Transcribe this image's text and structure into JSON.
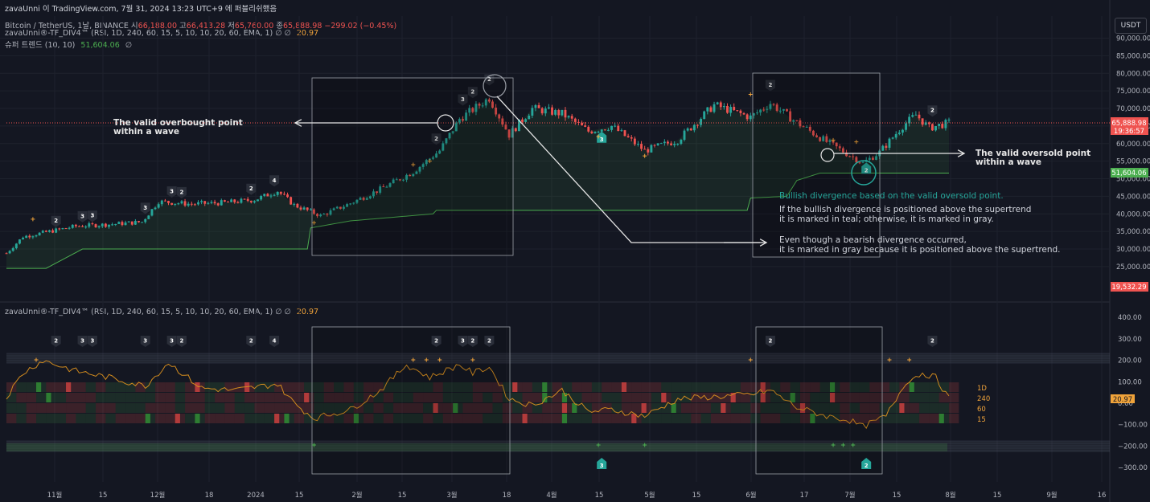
{
  "header": {
    "top_line": "zavaUnni 이 TradingView.com, 7월 31, 2024 13:23 UTC+9 에 퍼블리쉬했음",
    "symbol": "Bitcoin / TetherUS, 1날, BINANCE",
    "ohlc": [
      {
        "label": "시",
        "value": "66,188.00"
      },
      {
        "label": "고",
        "value": "66,413.28"
      },
      {
        "label": "저",
        "value": "65,760.00"
      },
      {
        "label": "종",
        "value": "65,888.98"
      }
    ],
    "change": "−299.02 (−0.45%)",
    "indicator1": "zavaUnni®-TF_DIV4™ (RSI, 1D, 240, 60, 15, 5, 10, 10, 20, 60, EMA, 1)  ∅  ∅",
    "indicator1_value": "20.97",
    "indicator2": "슈퍼 트렌드 (10, 10)",
    "indicator2_value": "51,604.06",
    "indicator2_suffix": "∅",
    "oscillator": "zavaUnni®-TF_DIV4™ (RSI, 1D, 240, 60, 15, 5, 10, 10, 20, 60, EMA, 1)  ∅  ∅",
    "oscillator_value": "20.97"
  },
  "currency_button": "USDT",
  "colors": {
    "background": "#141722",
    "up": "#26a69a",
    "down": "#ef5350",
    "supertrend": "#4caf50",
    "rsi": "#d08a1e",
    "teal": "#26a69a",
    "annotation": "#e6e6e6",
    "plus": "#f0a33a",
    "grid": "#1e222d"
  },
  "annotations": {
    "overbought": [
      "The valid overbought point",
      "within a wave"
    ],
    "oversold": [
      "The valid oversold point",
      "within a wave"
    ],
    "bullish_title": "Bullish divergence based on the valid oversold point.",
    "bullish_body": [
      "If the bullish divergence is positioned above the supertrend",
      "it is marked in teal; otherwise, it is marked in gray."
    ],
    "bearish": [
      "Even though a bearish divergence occurred,",
      "it is marked in gray because it is positioned above the supertrend."
    ]
  },
  "price_badges": {
    "current": "65,888.98",
    "countdown": "19:36:57",
    "supertrend": "51,604.06",
    "low": "19,532.29",
    "oscillator": "20.97"
  },
  "chart_data": [
    {
      "type": "candlestick",
      "title": "Bitcoin / TetherUS, 1날, BINANCE",
      "ylim": [
        20000,
        92000
      ],
      "y_ticks": [
        "90,000.00",
        "85,000.00",
        "80,000.00",
        "75,000.00",
        "70,000.00",
        "65,000.00",
        "60,000.00",
        "55,000.00",
        "50,000.00",
        "45,000.00",
        "40,000.00",
        "35,000.00",
        "30,000.00",
        "25,000.00"
      ],
      "x_ticks": [
        "11월",
        "15",
        "12월",
        "18",
        "2024",
        "15",
        "2월",
        "15",
        "3월",
        "18",
        "4월",
        "15",
        "5월",
        "15",
        "6월",
        "17",
        "7월",
        "15",
        "8월",
        "15",
        "9월",
        "16"
      ],
      "close_path": [
        [
          "2023-10-20",
          28800
        ],
        [
          "2023-10-25",
          33500
        ],
        [
          "2023-11-01",
          34800
        ],
        [
          "2023-11-10",
          36500
        ],
        [
          "2023-11-20",
          37000
        ],
        [
          "2023-11-30",
          37700
        ],
        [
          "2023-12-05",
          43500
        ],
        [
          "2023-12-15",
          42800
        ],
        [
          "2023-12-25",
          43200
        ],
        [
          "2024-01-03",
          44000
        ],
        [
          "2024-01-10",
          46500
        ],
        [
          "2024-01-15",
          42500
        ],
        [
          "2024-01-23",
          39500
        ],
        [
          "2024-02-01",
          43000
        ],
        [
          "2024-02-10",
          47000
        ],
        [
          "2024-02-20",
          52000
        ],
        [
          "2024-02-28",
          58000
        ],
        [
          "2024-03-05",
          67000
        ],
        [
          "2024-03-14",
          73000
        ],
        [
          "2024-03-20",
          62500
        ],
        [
          "2024-03-27",
          70000
        ],
        [
          "2024-04-05",
          68500
        ],
        [
          "2024-04-13",
          63500
        ],
        [
          "2024-04-20",
          65000
        ],
        [
          "2024-04-30",
          58000
        ],
        [
          "2024-05-10",
          61000
        ],
        [
          "2024-05-21",
          71000
        ],
        [
          "2024-06-01",
          67500
        ],
        [
          "2024-06-07",
          71500
        ],
        [
          "2024-06-15",
          66000
        ],
        [
          "2024-06-24",
          60500
        ],
        [
          "2024-07-05",
          54500
        ],
        [
          "2024-07-10",
          57500
        ],
        [
          "2024-07-17",
          65000
        ],
        [
          "2024-07-21",
          68200
        ],
        [
          "2024-07-25",
          64500
        ],
        [
          "2024-07-31",
          65888.98
        ]
      ],
      "supertrend": [
        [
          "2023-10-20",
          24500
        ],
        [
          "2023-11-01",
          24500
        ],
        [
          "2023-11-12",
          30000
        ],
        [
          "2024-01-19",
          30000
        ],
        [
          "2024-01-20",
          36000
        ],
        [
          "2024-02-01",
          38000
        ],
        [
          "2024-02-26",
          40000
        ],
        [
          "2024-02-27",
          41000
        ],
        [
          "2024-05-31",
          41000
        ],
        [
          "2024-06-01",
          44500
        ],
        [
          "2024-06-12",
          45000
        ],
        [
          "2024-06-15",
          49500
        ],
        [
          "2024-06-22",
          51604.06
        ],
        [
          "2024-07-31",
          51604.06
        ]
      ],
      "divergence_labels": [
        {
          "date": "2023-11-04",
          "text": "2"
        },
        {
          "date": "2023-11-12",
          "text": "3"
        },
        {
          "date": "2023-11-15",
          "text": "3"
        },
        {
          "date": "2023-12-01",
          "text": "3"
        },
        {
          "date": "2023-12-09",
          "text": "3"
        },
        {
          "date": "2023-12-12",
          "text": "2"
        },
        {
          "date": "2024-01-02",
          "text": "2"
        },
        {
          "date": "2024-01-09",
          "text": "4"
        },
        {
          "date": "2024-02-27",
          "text": "2"
        },
        {
          "date": "2024-03-06",
          "text": "3"
        },
        {
          "date": "2024-03-09",
          "text": "2"
        },
        {
          "date": "2024-03-14",
          "text": "2"
        },
        {
          "date": "2024-06-07",
          "text": "2"
        },
        {
          "date": "2024-07-26",
          "text": "2"
        }
      ],
      "teal_labels": [
        {
          "date": "2024-04-17",
          "text": "3"
        },
        {
          "date": "2024-07-06",
          "text": "2"
        }
      ]
    },
    {
      "type": "line",
      "title": "zavaUnni®-TF_DIV4™ oscillator",
      "ylim": [
        -320,
        420
      ],
      "y_ticks": [
        "400.00",
        "300.00",
        "200.00",
        "100.00",
        "0.00",
        "−100.00",
        "−200.00",
        "−300.00"
      ],
      "timeframe_rows": [
        "1D",
        "240",
        "60",
        "15"
      ],
      "rsi_path": [
        [
          "2023-10-20",
          30
        ],
        [
          "2023-10-25",
          140
        ],
        [
          "2023-10-31",
          200
        ],
        [
          "2023-11-10",
          150
        ],
        [
          "2023-11-20",
          120
        ],
        [
          "2023-12-01",
          80
        ],
        [
          "2023-12-08",
          190
        ],
        [
          "2023-12-18",
          70
        ],
        [
          "2023-12-28",
          60
        ],
        [
          "2024-01-10",
          90
        ],
        [
          "2024-01-15",
          0
        ],
        [
          "2024-01-21",
          -70
        ],
        [
          "2024-02-01",
          -30
        ],
        [
          "2024-02-10",
          60
        ],
        [
          "2024-02-18",
          180
        ],
        [
          "2024-02-25",
          120
        ],
        [
          "2024-03-05",
          180
        ],
        [
          "2024-03-09",
          140
        ],
        [
          "2024-03-14",
          170
        ],
        [
          "2024-03-20",
          20
        ],
        [
          "2024-03-27",
          -10
        ],
        [
          "2024-04-05",
          60
        ],
        [
          "2024-04-13",
          -40
        ],
        [
          "2024-04-20",
          -30
        ],
        [
          "2024-04-30",
          -60
        ],
        [
          "2024-05-10",
          20
        ],
        [
          "2024-05-21",
          30
        ],
        [
          "2024-06-01",
          40
        ],
        [
          "2024-06-07",
          60
        ],
        [
          "2024-06-15",
          -20
        ],
        [
          "2024-06-24",
          -60
        ],
        [
          "2024-07-01",
          -80
        ],
        [
          "2024-07-05",
          -110
        ],
        [
          "2024-07-12",
          -60
        ],
        [
          "2024-07-18",
          100
        ],
        [
          "2024-07-23",
          140
        ],
        [
          "2024-07-27",
          120
        ],
        [
          "2024-07-31",
          20.97
        ]
      ],
      "labels": [
        {
          "date": "2023-11-04",
          "text": "2"
        },
        {
          "date": "2023-11-12",
          "text": "3"
        },
        {
          "date": "2023-11-15",
          "text": "3"
        },
        {
          "date": "2023-12-01",
          "text": "3"
        },
        {
          "date": "2023-12-09",
          "text": "3"
        },
        {
          "date": "2023-12-12",
          "text": "2"
        },
        {
          "date": "2024-01-02",
          "text": "2"
        },
        {
          "date": "2024-01-09",
          "text": "4"
        },
        {
          "date": "2024-02-27",
          "text": "2"
        },
        {
          "date": "2024-03-06",
          "text": "3"
        },
        {
          "date": "2024-03-09",
          "text": "2"
        },
        {
          "date": "2024-03-14",
          "text": "2"
        },
        {
          "date": "2024-06-07",
          "text": "2"
        },
        {
          "date": "2024-07-26",
          "text": "2"
        }
      ],
      "teal_labels": [
        {
          "date": "2024-04-17",
          "text": "3"
        },
        {
          "date": "2024-07-06",
          "text": "2"
        }
      ]
    }
  ]
}
